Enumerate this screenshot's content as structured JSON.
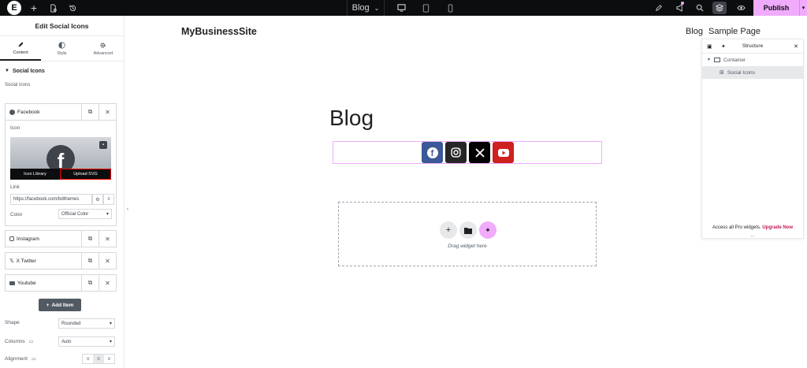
{
  "topbar": {
    "page_selector": "Blog",
    "publish_label": "Publish"
  },
  "panel": {
    "title": "Edit Social Icons",
    "tabs": [
      {
        "label": "Content"
      },
      {
        "label": "Style"
      },
      {
        "label": "Advanced"
      }
    ],
    "section_title": "Social Icons",
    "list_label": "Social Icons",
    "items": [
      {
        "label": "Facebook"
      },
      {
        "label": "Instagram"
      },
      {
        "label": "X Twitter"
      },
      {
        "label": "Youtube"
      }
    ],
    "icon_label": "Icon",
    "icon_library": "Icon Library",
    "upload_svg": "Upload SVG",
    "link_label": "Link",
    "link_value": "https://facebook.com/bdthemes",
    "color_label": "Color",
    "color_value": "Official Color",
    "add_item": "Add Item",
    "shape_label": "Shape",
    "shape_value": "Rounded",
    "columns_label": "Columns",
    "columns_value": "Auto",
    "alignment_label": "Alignment"
  },
  "canvas": {
    "site_title": "MyBusinessSite",
    "nav": [
      "Blog",
      "Sample Page"
    ],
    "heading": "Blog",
    "social_colors": [
      "#3b5998",
      "#262626",
      "#000000",
      "#cd201f"
    ],
    "dropzone_text": "Drag widget here"
  },
  "structure": {
    "title": "Structure",
    "tree": [
      {
        "label": "Container"
      },
      {
        "label": "Social Icons"
      }
    ],
    "footer_text": "Access all Pro widgets.",
    "footer_link": "Upgrade Now",
    "dots": "..."
  },
  "colors": {
    "accent": "#f0abfc",
    "topbar": "#0c0d0e"
  }
}
